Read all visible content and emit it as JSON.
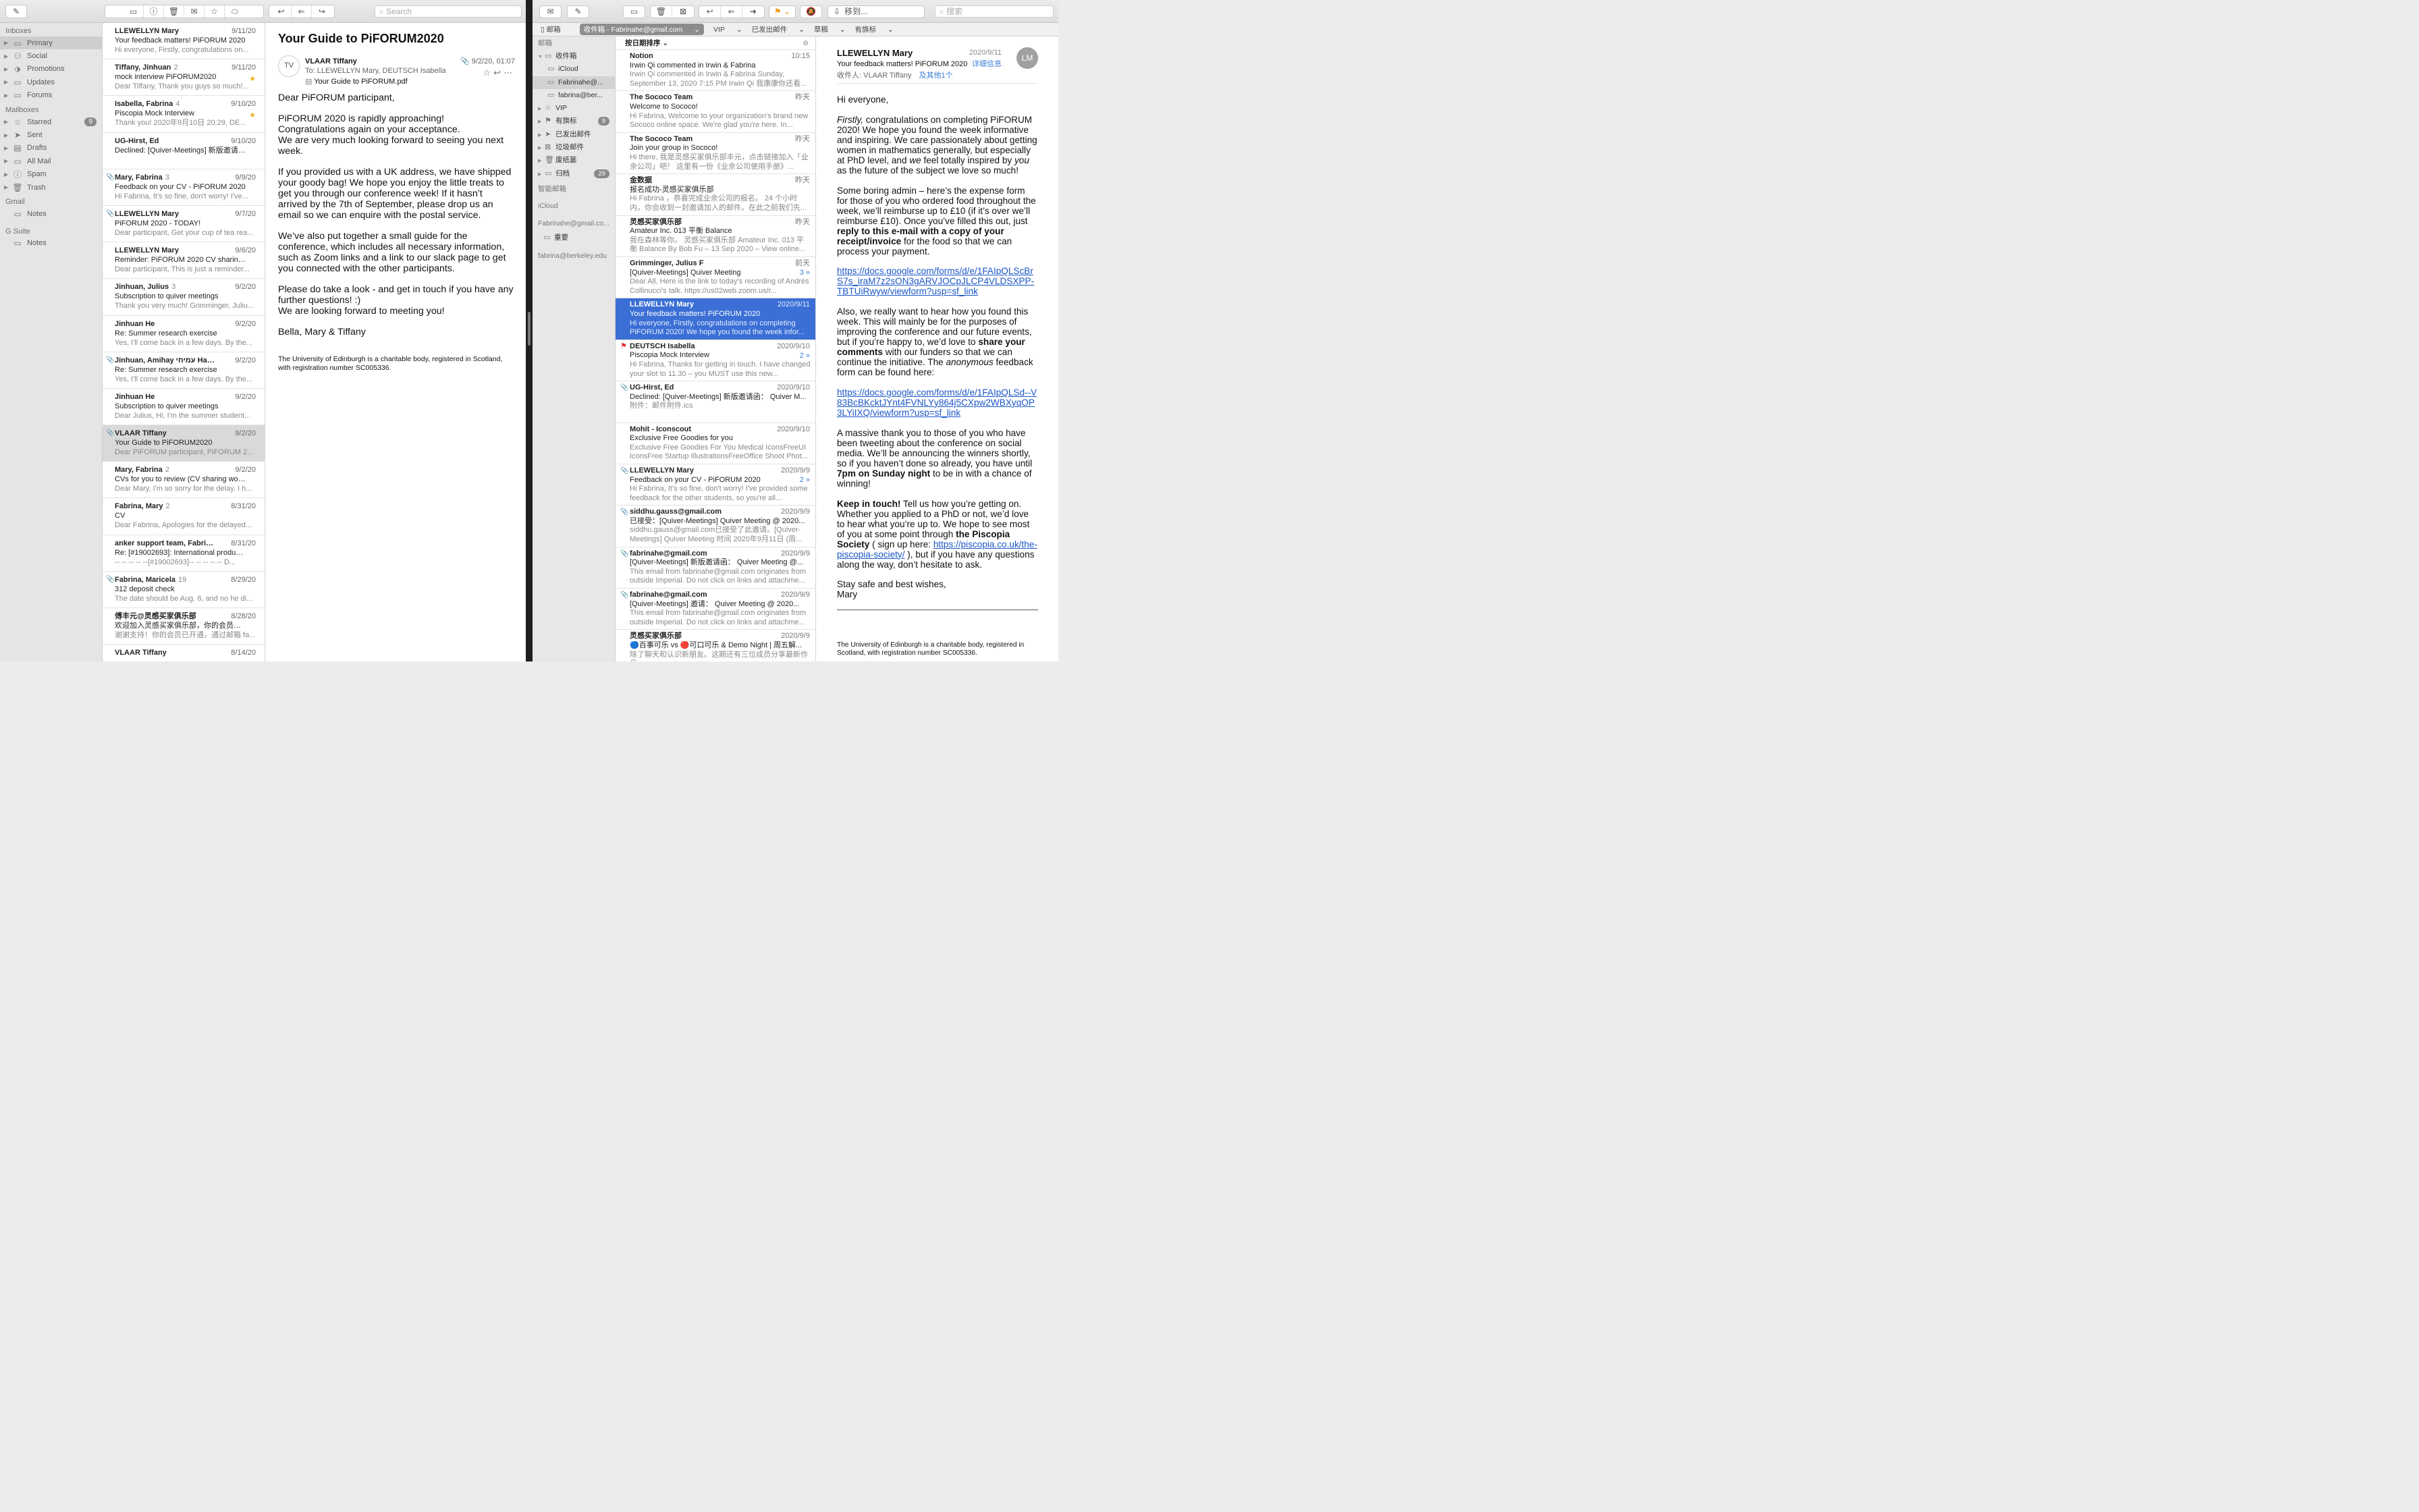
{
  "left": {
    "toolbar": {
      "search_placeholder": "Search"
    },
    "sidebar": {
      "inboxes_header": "Inboxes",
      "inboxes": [
        {
          "label": "Primary",
          "icon": "inbox-icon"
        },
        {
          "label": "Social",
          "icon": "people-icon"
        },
        {
          "label": "Promotions",
          "icon": "tag-icon"
        },
        {
          "label": "Updates",
          "icon": "inbox-icon"
        },
        {
          "label": "Forums",
          "icon": "inbox-icon"
        }
      ],
      "mailboxes_header": "Mailboxes",
      "mailboxes": [
        {
          "label": "Starred",
          "icon": "star-icon",
          "badge": "9"
        },
        {
          "label": "Sent",
          "icon": "send-icon"
        },
        {
          "label": "Drafts",
          "icon": "document-icon"
        },
        {
          "label": "All Mail",
          "icon": "tray-icon"
        },
        {
          "label": "Spam",
          "icon": "spam-icon"
        },
        {
          "label": "Trash",
          "icon": "trash-icon"
        }
      ],
      "gmail_header": "Gmail",
      "gmail_notes": "Notes",
      "gsuite_header": "G Suite",
      "gsuite_notes": "Notes"
    },
    "messages": [
      {
        "from": "LLEWELLYN Mary",
        "count": "",
        "date": "9/11/20",
        "subject": "Your feedback matters! PiFORUM 2020",
        "preview": "Hi everyone, Firstly, congratulations on...",
        "att": false,
        "star": false
      },
      {
        "from": "Tiffany, Jinhuan",
        "count": "2",
        "date": "9/11/20",
        "subject": "mock interview PiFORUM2020",
        "preview": "Dear Tiffany, Thank you guys so much!...",
        "att": false,
        "star": true
      },
      {
        "from": "Isabella, Fabrina",
        "count": "4",
        "date": "9/10/20",
        "subject": "Piscopia Mock Interview",
        "preview": "Thank you! 2020年9月10日 20:29, DE...",
        "att": false,
        "star": true
      },
      {
        "from": "UG-Hirst, Ed",
        "count": "",
        "date": "9/10/20",
        "subject": "Declined: [Quiver-Meetings] 新版邀请函...",
        "preview": "",
        "att": false,
        "star": false
      },
      {
        "from": "Mary, Fabrina",
        "count": "3",
        "date": "9/9/20",
        "subject": "Feedback on your CV - PiFORUM 2020",
        "preview": "Hi Fabrina, It's so fine, don't worry! I've...",
        "att": true,
        "star": false
      },
      {
        "from": "LLEWELLYN Mary",
        "count": "",
        "date": "9/7/20",
        "subject": "PiFORUM 2020 - TODAY!",
        "preview": "Dear participant, Get your cup of tea rea...",
        "att": true,
        "star": false
      },
      {
        "from": "LLEWELLYN Mary",
        "count": "",
        "date": "9/6/20",
        "subject": "Reminder: PiFORUM 2020 CV sharing w...",
        "preview": "Dear participant, This is just a reminder...",
        "att": false,
        "star": false
      },
      {
        "from": "Jinhuan, Julius",
        "count": "3",
        "date": "9/2/20",
        "subject": "Subscription to quiver meetings",
        "preview": "Thank you very much! Grimminger, Juliu...",
        "att": false,
        "star": false
      },
      {
        "from": "Jinhuan He",
        "count": "",
        "date": "9/2/20",
        "subject": "Re: Summer research exercise",
        "preview": "Yes, I'll come back in a few days. By the...",
        "att": false,
        "star": false
      },
      {
        "from": "Jinhuan, Amihay עמיחי Han...",
        "count": "15",
        "date": "9/2/20",
        "subject": "Re: Summer research exercise",
        "preview": "Yes, I'll come back in a few days. By the...",
        "att": true,
        "star": false
      },
      {
        "from": "Jinhuan He",
        "count": "",
        "date": "9/2/20",
        "subject": "Subscription to quiver meetings",
        "preview": "Dear Julius, Hi, I'm the summer student...",
        "att": false,
        "star": false
      },
      {
        "from": "VLAAR Tiffany",
        "count": "",
        "date": "9/2/20",
        "subject": "Your Guide to PiFORUM2020",
        "preview": "Dear PiFORUM participant, PiFORUM 20...",
        "att": true,
        "star": false,
        "selected": true
      },
      {
        "from": "Mary, Fabrina",
        "count": "2",
        "date": "9/2/20",
        "subject": "CVs for you to review (CV sharing works...",
        "preview": "Dear Mary, I'm so sorry for the delay. I h...",
        "att": false,
        "star": false
      },
      {
        "from": "Fabrina, Mary",
        "count": "2",
        "date": "8/31/20",
        "subject": "CV",
        "preview": "Dear Fabrina, Apologies for the delayed...",
        "att": false,
        "star": false
      },
      {
        "from": "anker support team, Fabrina",
        "count": "7",
        "date": "8/31/20",
        "subject": "Re: [#19002693]: International product...",
        "preview": "-- -- -- -- --[#19002693]-- -- -- -- -- D...",
        "att": false,
        "star": false
      },
      {
        "from": "Fabrina, Maricela",
        "count": "19",
        "date": "8/29/20",
        "subject": "312 deposit check",
        "preview": "The date should be Aug. 6, and no he di...",
        "att": true,
        "star": false
      },
      {
        "from": "傅丰元@灵感买家俱乐部",
        "count": "",
        "date": "8/28/20",
        "subject": "欢迎加入灵感买家俱乐部，你的会员已开通",
        "preview": "谢谢支持！你的会员已开通，通过邮箱 fa...",
        "att": false,
        "star": false
      },
      {
        "from": "VLAAR Tiffany",
        "count": "",
        "date": "8/14/20",
        "subject": "",
        "preview": "",
        "att": false,
        "star": false
      }
    ],
    "reader": {
      "title": "Your Guide to PiFORUM2020",
      "avatar": "TV",
      "from": "VLAAR Tiffany",
      "date": "9/2/20, 01:07",
      "to_label": "To:",
      "to": "LLEWELLYN Mary,   DEUTSCH Isabella",
      "attachment": "Your Guide to PiFORUM.pdf",
      "body": [
        "Dear PiFORUM participant,",
        "PiFORUM 2020 is rapidly approaching! Congratulations again on your acceptance.\nWe are very much looking forward to seeing you next week.",
        "If you provided us with a UK address, we have shipped your goody bag! We hope you enjoy the little treats to get you through our conference week! If it hasn’t arrived by the 7th of September, please drop us an email so we can enquire with the postal service.",
        "We’ve also put together a small guide for the conference, which includes all necessary information, such as Zoom links and a link to our slack page to get you connected with the other participants.",
        "Please do take a look - and get in touch if you have any further questions! :)\nWe are looking forward to meeting you!",
        "Bella, Mary & Tiffany"
      ],
      "footer": "The University of Edinburgh is a charitable body, registered in Scotland, with registration number SC005336."
    }
  },
  "right": {
    "toolbar": {
      "move_label": "移到...",
      "search_placeholder": "搜索"
    },
    "favorites": {
      "mailbox": "邮箱",
      "inbox": "收件箱 - Fabrinahe@gmail.com",
      "vip": "VIP",
      "sent": "已发出邮件",
      "drafts": "草稿",
      "flagged": "有旗标"
    },
    "sidebar": {
      "header": "邮箱",
      "items": [
        {
          "label": "收件箱",
          "icon": "inbox-icon",
          "level": 0,
          "open": true
        },
        {
          "label": "iCloud",
          "icon": "inbox-icon",
          "level": 1
        },
        {
          "label": "Fabrinahe@...",
          "icon": "inbox-icon",
          "level": 1,
          "selected": true
        },
        {
          "label": "fabrina@ber...",
          "icon": "inbox-icon",
          "level": 1
        },
        {
          "label": "VIP",
          "icon": "star-icon",
          "level": 0
        },
        {
          "label": "有旗标",
          "icon": "flag-icon",
          "level": 0,
          "badge": "9"
        },
        {
          "label": "已发出邮件",
          "icon": "send-icon",
          "level": 0
        },
        {
          "label": "垃圾邮件",
          "icon": "junk-icon",
          "level": 0
        },
        {
          "label": "废纸篓",
          "icon": "trash-icon",
          "level": 0
        },
        {
          "label": "归档",
          "icon": "archive-icon",
          "level": 0,
          "badge": "29"
        }
      ],
      "smart": "智能邮箱",
      "icloud": "iCloud",
      "gmail": "Fabrinahe@gmail.co...",
      "gmail_sub": "重要",
      "berkeley": "fabrina@berkeley.edu"
    },
    "sort_label": "按日期排序",
    "messages": [
      {
        "from": "Notion",
        "date": "10:15",
        "subject": "Irwin Qi commented in Irwin & Fabrina",
        "preview": "Irwin Qi commented in Irwin & Fabrina Sunday, September 13, 2020 7:15 PM Irwin Qi 我康康你还看...",
        "count": ""
      },
      {
        "from": "The Sococo Team",
        "date": "昨天",
        "subject": "Welcome to Sococo!",
        "preview": "Hi Fabrina, Welcome to your organization's brand new Sococo online space. We're glad you're here. In...",
        "count": ""
      },
      {
        "from": "The Sococo Team",
        "date": "昨天",
        "subject": "Join your group in Sococo!",
        "preview": "Hi there, 我是灵感买家俱乐部丰元，点击链接加入「业余公司」吧！ 这里有一份《业余公司使用手册》...",
        "count": ""
      },
      {
        "from": "金数据",
        "date": "昨天",
        "subject": "报名成功-灵感买家俱乐部",
        "preview": "Hi Fabrina ，恭喜完成业余公司的报名。 24 个小时内，你会收到一封邀请加入的邮件。在此之前我们先...",
        "count": ""
      },
      {
        "from": "灵感买家俱乐部",
        "date": "昨天",
        "subject": "Amateur Inc. 013 平衡 Balance",
        "preview": "我在森林等你。 灵感买家俱乐部 Amateur Inc. 013 平衡 Balance By Bob Fu – 13 Sep 2020 – View online...",
        "count": ""
      },
      {
        "from": "Grimminger, Julius F",
        "date": "前天",
        "subject": "[Quiver-Meetings] Quiver Meeting",
        "preview": "Dear All, Here is the link to today's recording of Andrés Collinucci's talk. https://us02web.zoom.us/r...",
        "count": "3 »"
      },
      {
        "from": "LLEWELLYN Mary",
        "date": "2020/9/11",
        "subject": "Your feedback matters! PiFORUM 2020",
        "preview": "Hi everyone, Firstly, congratulations on completing PiFORUM 2020! We hope you found the week infor...",
        "count": "",
        "selected": true
      },
      {
        "from": "DEUTSCH Isabella",
        "date": "2020/9/10",
        "subject": "Piscopia Mock Interview",
        "preview": "Hi Fabrina, Thanks for getting in touch. I have changed your slot to 11.30 – you MUST use this new...",
        "count": "2 »",
        "flag": true
      },
      {
        "from": "UG-Hirst, Ed",
        "date": "2020/9/10",
        "subject": "Declined: [Quiver-Meetings] 新版邀请函： Quiver M...",
        "preview": "附件：邮件附件.ics",
        "count": "",
        "att": true
      },
      {
        "from": "Mohit - Iconscout",
        "date": "2020/9/10",
        "subject": "Exclusive Free Goodies for you",
        "preview": "Exclusive Free Goodies For You Medical IconsFreeUI IconsFree Startup IllustrationsFreeOffice Shoot Phot...",
        "count": ""
      },
      {
        "from": "LLEWELLYN Mary",
        "date": "2020/9/9",
        "subject": "Feedback on your CV - PiFORUM 2020",
        "preview": "Hi Fabrina, It's so fine, don't worry! I've provided some feedback for the other students, so you're all...",
        "count": "2 »",
        "att": true
      },
      {
        "from": "siddhu.gauss@gmail.com",
        "date": "2020/9/9",
        "subject": "已接受：[Quiver-Meetings] Quiver Meeting @ 2020...",
        "preview": "siddhu.gauss@gmail.com已接受了此邀请。[Quiver-Meetings] Quiver Meeting 时间 2020年9月11日 (周...",
        "count": "",
        "att": true
      },
      {
        "from": "fabrinahe@gmail.com",
        "date": "2020/9/9",
        "subject": "[Quiver-Meetings] 新版邀请函： Quiver Meeting @...",
        "preview": "This email from fabrinahe@gmail.com originates from outside Imperial. Do not click on links and attachme...",
        "count": "",
        "att": true
      },
      {
        "from": "fabrinahe@gmail.com",
        "date": "2020/9/9",
        "subject": "[Quiver-Meetings] 邀请： Quiver Meeting @ 2020...",
        "preview": "This email from fabrinahe@gmail.com originates from outside Imperial. Do not click on links and attachme...",
        "count": "",
        "att": true
      },
      {
        "from": "灵感买家俱乐部",
        "date": "2020/9/9",
        "subject": "🔵百事可乐 vs 🔴可口可乐 & Demo Night | 周五解...",
        "preview": "除了聊天和认识新朋友。这期还有三位成员分享最新作品",
        "count": ""
      }
    ],
    "reader": {
      "from": "LLEWELLYN Mary",
      "date": "2020/9/11",
      "subject": "Your feedback matters! PiFORUM 2020",
      "details": "详细信息",
      "to_label": "收件人:",
      "to": "VLAAR Tiffany",
      "others": "及其他1个",
      "avatar": "LM",
      "greeting": "Hi everyone,",
      "p1_em": "Firstly,",
      "p1a": " congratulations on completing PiFORUM 2020! We hope you found the week informative and inspiring. We care passionately about getting women in mathematics generally, but especially at PhD level, and ",
      "p1_we": "we",
      "p1b": " feel totally inspired by ",
      "p1_you": "you",
      "p1c": " as the future of the subject we love so much!",
      "p2a": "Some boring admin – here’s the expense form for those of you who ordered food throughout the week, we’ll reimburse up to £10 (if it’s over we’ll reimburse £10). Once you’ve filled this out, just ",
      "p2b": "reply to this e-mail with a copy of your receipt/invoice",
      "p2c": " for the food so that we can process your payment.",
      "link1": "https://docs.google.com/forms/d/e/1FAIpQLScBrS7s_iraM7z2sON3gARVJOCpJLCP4VLDSXPP-TBTUiRwyw/viewform?usp=sf_link",
      "p3a": "Also, we really want to hear how you found this week. This will mainly be for the purposes of improving the conference and our future events, but if you’re happy to, we’d love to ",
      "p3b": "share your comments",
      "p3c": " with our funders so that we can continue the initiative. The ",
      "p3d": "anonymous",
      "p3e": " feedback form can be found here:",
      "link2": "https://docs.google.com/forms/d/e/1FAIpQLSd--V83BcBKcktJYnt4FVNLYy864j5CXpw2WBXyqOP3LYiIXQ/viewform?usp=sf_link",
      "p4a": "A massive thank you to those of you who have been tweeting about the conference on social media. We’ll be announcing the winners shortly, so if you haven’t done so already, you have until ",
      "p4b": "7pm on Sunday night",
      "p4c": " to be in with a chance of winning!",
      "p5a": "Keep in touch!",
      "p5b": " Tell us how you’re getting on. Whether you applied to a PhD or not, we’d love to hear what you’re up to. We hope to see most of you at some point through ",
      "p5c": "the Piscopia Society",
      "p5d": " ( sign up here: ",
      "link3": "https://piscopia.co.uk/the-piscopia-society/",
      "p5e": " ), but if you have any questions along the way, don’t hesitate to ask.",
      "signoff1": "Stay safe and best wishes,",
      "signoff2": "Mary",
      "footer": "The University of Edinburgh is a charitable body, registered in Scotland, with registration number SC005336."
    }
  }
}
